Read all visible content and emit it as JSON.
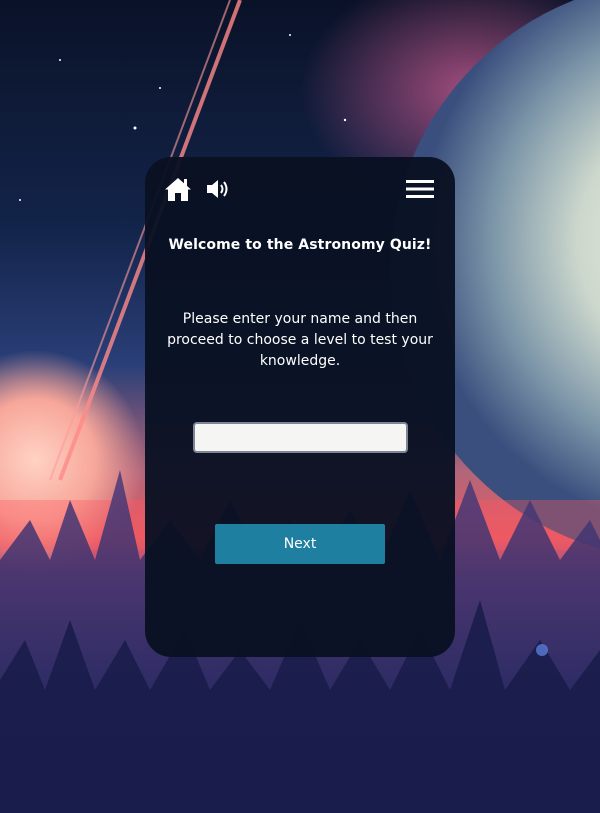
{
  "toolbar": {
    "home_icon": "home-icon",
    "sound_icon": "volume-icon",
    "menu_icon": "hamburger-menu-icon"
  },
  "quiz": {
    "title": "Welcome to the Astronomy Quiz!",
    "instructions": "Please enter your name and then proceed to choose a level to test your knowledge.",
    "name_input_value": "",
    "next_label": "Next"
  },
  "colors": {
    "card_background": "#091122",
    "button": "#1e7fa0",
    "text": "#ffffff"
  }
}
